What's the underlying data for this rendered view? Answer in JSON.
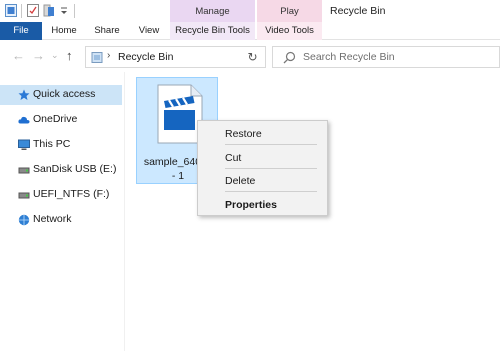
{
  "window": {
    "title": "Recycle Bin"
  },
  "ribbon": {
    "tabs": [
      "File",
      "Home",
      "Share",
      "View"
    ],
    "contextual_groups": [
      {
        "label": "Manage",
        "tab": "Recycle Bin Tools",
        "color": "#ead7f2"
      },
      {
        "label": "Play",
        "tab": "Video Tools",
        "color": "#f6d9e6"
      }
    ],
    "file_tab_color": "#1a5ba6"
  },
  "address": {
    "path": "Recycle Bin",
    "search_placeholder": "Search Recycle Bin"
  },
  "sidebar": {
    "items": [
      {
        "label": "Quick access",
        "icon": "star-icon",
        "selected": true
      },
      {
        "label": "OneDrive",
        "icon": "cloud-icon",
        "selected": false
      },
      {
        "label": "This PC",
        "icon": "computer-icon",
        "selected": false
      },
      {
        "label": "SanDisk USB (E:)",
        "icon": "usb-drive-icon",
        "selected": false
      },
      {
        "label": "UEFI_NTFS (F:)",
        "icon": "usb-drive-icon",
        "selected": false
      },
      {
        "label": "Network",
        "icon": "network-icon",
        "selected": false
      }
    ]
  },
  "files": [
    {
      "name_line1": "sample_640x3",
      "name_line2": "- 1",
      "icon": "video-file-icon",
      "selected": true
    }
  ],
  "context_menu": {
    "items": [
      {
        "label": "Restore",
        "bold": false
      },
      {
        "label": "Cut",
        "bold": false
      },
      {
        "label": "Delete",
        "bold": false
      },
      {
        "label": "Properties",
        "bold": true
      }
    ]
  }
}
